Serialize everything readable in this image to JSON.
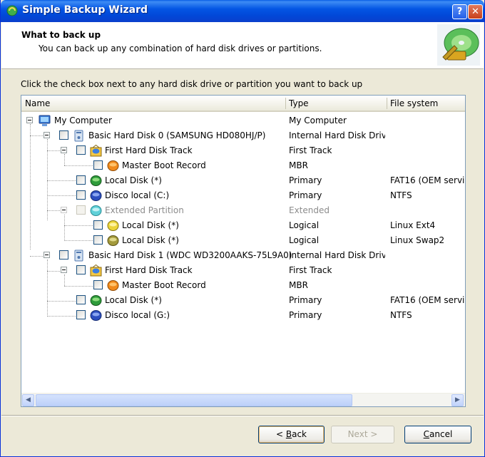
{
  "window": {
    "title": "Simple Backup Wizard",
    "help_label": "?",
    "close_label": "✕"
  },
  "header": {
    "title": "What to back up",
    "subtitle": "You can back up any combination of hard disk drives or partitions."
  },
  "instruction": "Click the check box next to any hard disk drive or partition you want to back up",
  "columns": {
    "name": "Name",
    "type": "Type",
    "fs": "File system"
  },
  "rows": [
    {
      "name": "My Computer",
      "type": "My Computer",
      "fs": ""
    },
    {
      "name": "Basic Hard Disk 0 (SAMSUNG HD080HJ/P)",
      "type": "Internal Hard Disk Drive",
      "fs": ""
    },
    {
      "name": "First Hard Disk Track",
      "type": "First Track",
      "fs": ""
    },
    {
      "name": "Master Boot Record",
      "type": "MBR",
      "fs": ""
    },
    {
      "name": "Local Disk (*)",
      "type": "Primary",
      "fs": "FAT16 (OEM servi"
    },
    {
      "name": "Disco local (C:)",
      "type": "Primary",
      "fs": "NTFS"
    },
    {
      "name": "Extended Partition",
      "type": "Extended",
      "fs": ""
    },
    {
      "name": "Local Disk (*)",
      "type": "Logical",
      "fs": "Linux Ext4"
    },
    {
      "name": "Local Disk (*)",
      "type": "Logical",
      "fs": "Linux Swap2"
    },
    {
      "name": "Basic Hard Disk 1 (WDC WD3200AAKS-75L9A0)",
      "type": "Internal Hard Disk Drive",
      "fs": ""
    },
    {
      "name": "First Hard Disk Track",
      "type": "First Track",
      "fs": ""
    },
    {
      "name": "Master Boot Record",
      "type": "MBR",
      "fs": ""
    },
    {
      "name": "Local Disk (*)",
      "type": "Primary",
      "fs": "FAT16 (OEM servi"
    },
    {
      "name": "Disco local (G:)",
      "type": "Primary",
      "fs": "NTFS"
    }
  ],
  "buttons": {
    "back_prefix": "< ",
    "back_key": "B",
    "back_rest": "ack",
    "next_label": "Next >",
    "cancel_key": "C",
    "cancel_rest": "ancel"
  },
  "colors": {
    "title_bar": "#0454e2",
    "accent": "#316ac5",
    "disk_green": "#2e9b3a",
    "disk_blue": "#2d4fbf",
    "disk_orange": "#f08a1c"
  }
}
